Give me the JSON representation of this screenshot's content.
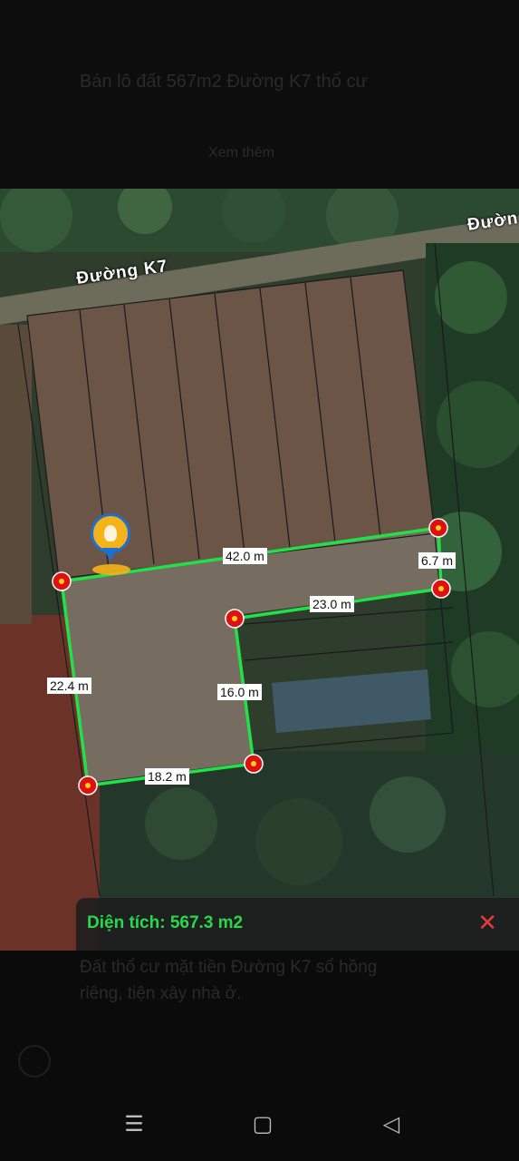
{
  "top": {
    "title": "Bán lô đất 567m2 Đường K7 thổ cư",
    "subtitle": "Xem thêm"
  },
  "map": {
    "road_labels": [
      "Đường K7",
      "Đườn"
    ],
    "measurements": [
      "42.0 m",
      "6.7 m",
      "23.0 m",
      "16.0 m",
      "22.4 m",
      "18.2 m"
    ],
    "area_label": "Diện tích: 567.3 m2",
    "close_icon": "close-icon",
    "pin_icon": "location-pin-icon",
    "polygon_color": "#22e04a",
    "vertex_color": "#e01010"
  },
  "lower": {
    "text": "Đất thổ cư mặt tiền Đường K7 sổ hồng riêng, tiện xây nhà ở."
  },
  "nav": {
    "menu": "☰",
    "home": "▢",
    "back": "◁"
  }
}
